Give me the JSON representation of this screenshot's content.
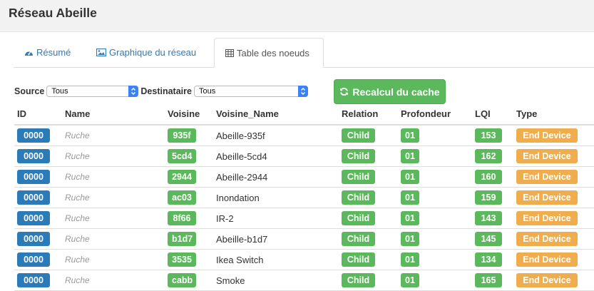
{
  "header": {
    "title": "Réseau Abeille"
  },
  "tabs": [
    {
      "label": "Résumé",
      "icon": "dashboard-icon",
      "active": false
    },
    {
      "label": "Graphique du réseau",
      "icon": "image-icon",
      "active": false
    },
    {
      "label": "Table des noeuds",
      "icon": "table-icon",
      "active": true
    }
  ],
  "filters": {
    "source_label": "Source",
    "source_value": "Tous",
    "dest_label": "Destinataire",
    "dest_value": "Tous"
  },
  "recalc_button": {
    "label": "Recalcul du cache",
    "icon": "refresh-icon"
  },
  "table": {
    "headers": [
      "ID",
      "Name",
      "Voisine",
      "Voisine_Name",
      "Relation",
      "Profondeur",
      "LQI",
      "Type"
    ],
    "rows": [
      {
        "id": "0000",
        "name": "Ruche",
        "voisine": "935f",
        "voisine_name": "Abeille-935f",
        "relation": "Child",
        "profondeur": "01",
        "lqi": "153",
        "type": "End Device"
      },
      {
        "id": "0000",
        "name": "Ruche",
        "voisine": "5cd4",
        "voisine_name": "Abeille-5cd4",
        "relation": "Child",
        "profondeur": "01",
        "lqi": "162",
        "type": "End Device"
      },
      {
        "id": "0000",
        "name": "Ruche",
        "voisine": "2944",
        "voisine_name": "Abeille-2944",
        "relation": "Child",
        "profondeur": "01",
        "lqi": "160",
        "type": "End Device"
      },
      {
        "id": "0000",
        "name": "Ruche",
        "voisine": "ac03",
        "voisine_name": "Inondation",
        "relation": "Child",
        "profondeur": "01",
        "lqi": "159",
        "type": "End Device"
      },
      {
        "id": "0000",
        "name": "Ruche",
        "voisine": "8f66",
        "voisine_name": "IR-2",
        "relation": "Child",
        "profondeur": "01",
        "lqi": "143",
        "type": "End Device"
      },
      {
        "id": "0000",
        "name": "Ruche",
        "voisine": "b1d7",
        "voisine_name": "Abeille-b1d7",
        "relation": "Child",
        "profondeur": "01",
        "lqi": "145",
        "type": "End Device"
      },
      {
        "id": "0000",
        "name": "Ruche",
        "voisine": "3535",
        "voisine_name": "Ikea Switch",
        "relation": "Child",
        "profondeur": "01",
        "lqi": "134",
        "type": "End Device"
      },
      {
        "id": "0000",
        "name": "Ruche",
        "voisine": "cabb",
        "voisine_name": "Smoke",
        "relation": "Child",
        "profondeur": "01",
        "lqi": "165",
        "type": "End Device"
      }
    ]
  },
  "colors": {
    "primary": "#2b7bb9",
    "success": "#5cb85c",
    "warning": "#f0ad4e",
    "link": "#337ab7"
  }
}
